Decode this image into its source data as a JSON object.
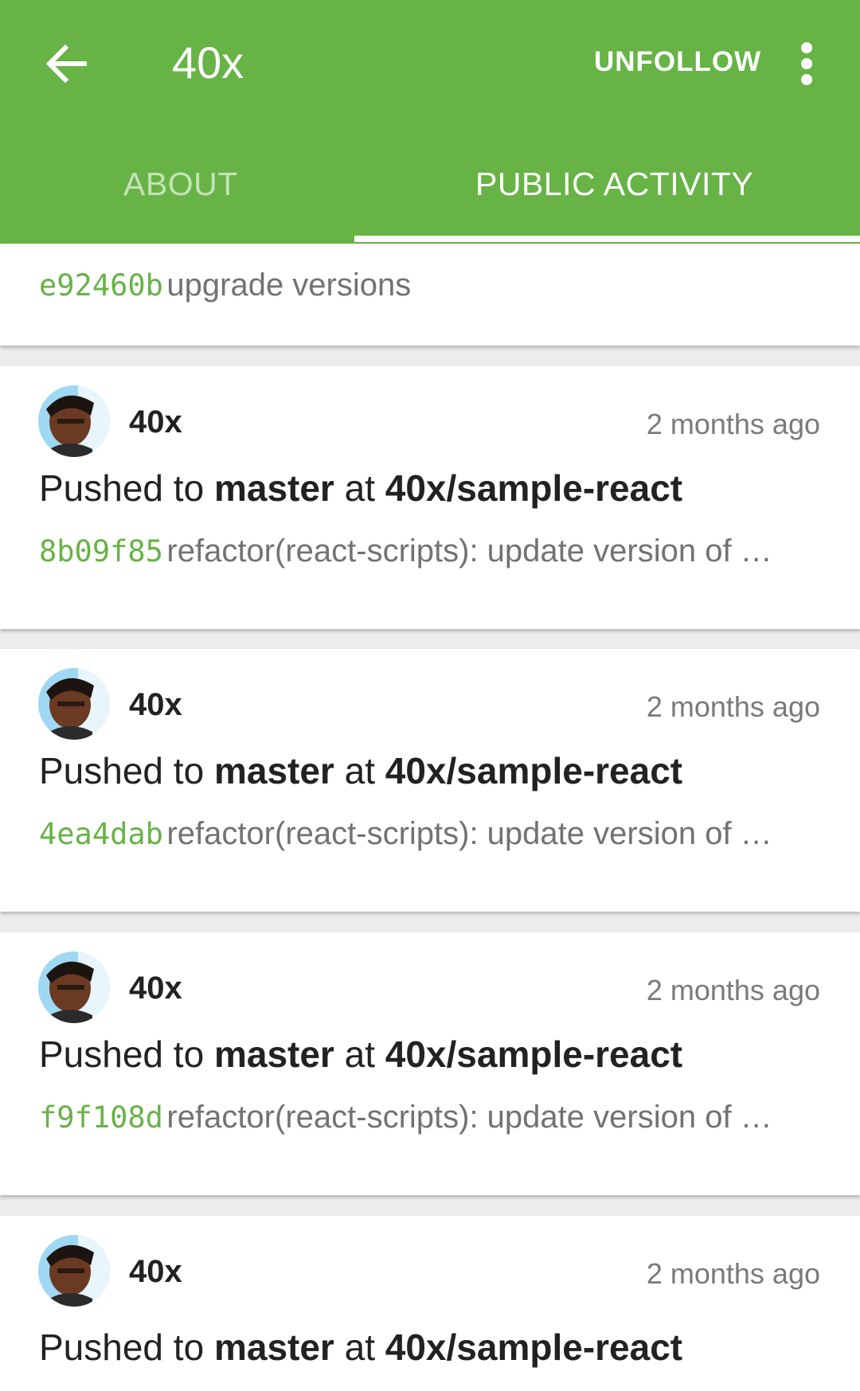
{
  "appbar": {
    "title": "40x",
    "unfollow_label": "UNFOLLOW",
    "back_icon": "arrow-left-icon",
    "more_icon": "more-vert-icon",
    "background": "#67b346"
  },
  "tabs": [
    {
      "label": "ABOUT",
      "selected": false
    },
    {
      "label": "PUBLIC ACTIVITY",
      "selected": true
    }
  ],
  "feed": {
    "partial_top": {
      "sha": "e92460b",
      "message": "upgrade versions"
    },
    "events": [
      {
        "actor": "40x",
        "time": "2 months ago",
        "text_pushed": "Pushed to",
        "branch": "master",
        "text_at": "at",
        "repo": "40x/sample-react",
        "sha": "8b09f85",
        "message": "refactor(react-scripts): update version of …"
      },
      {
        "actor": "40x",
        "time": "2 months ago",
        "text_pushed": "Pushed to",
        "branch": "master",
        "text_at": "at",
        "repo": "40x/sample-react",
        "sha": "4ea4dab",
        "message": "refactor(react-scripts): update version of …"
      },
      {
        "actor": "40x",
        "time": "2 months ago",
        "text_pushed": "Pushed to",
        "branch": "master",
        "text_at": "at",
        "repo": "40x/sample-react",
        "sha": "f9f108d",
        "message": "refactor(react-scripts): update version of …"
      },
      {
        "actor": "40x",
        "time": "2 months ago",
        "text_pushed": "Pushed to",
        "branch": "master",
        "text_at": "at",
        "repo": "40x/sample-react"
      }
    ]
  },
  "colors": {
    "accent": "#67b346",
    "sha": "#67b346",
    "muted": "#727272"
  }
}
